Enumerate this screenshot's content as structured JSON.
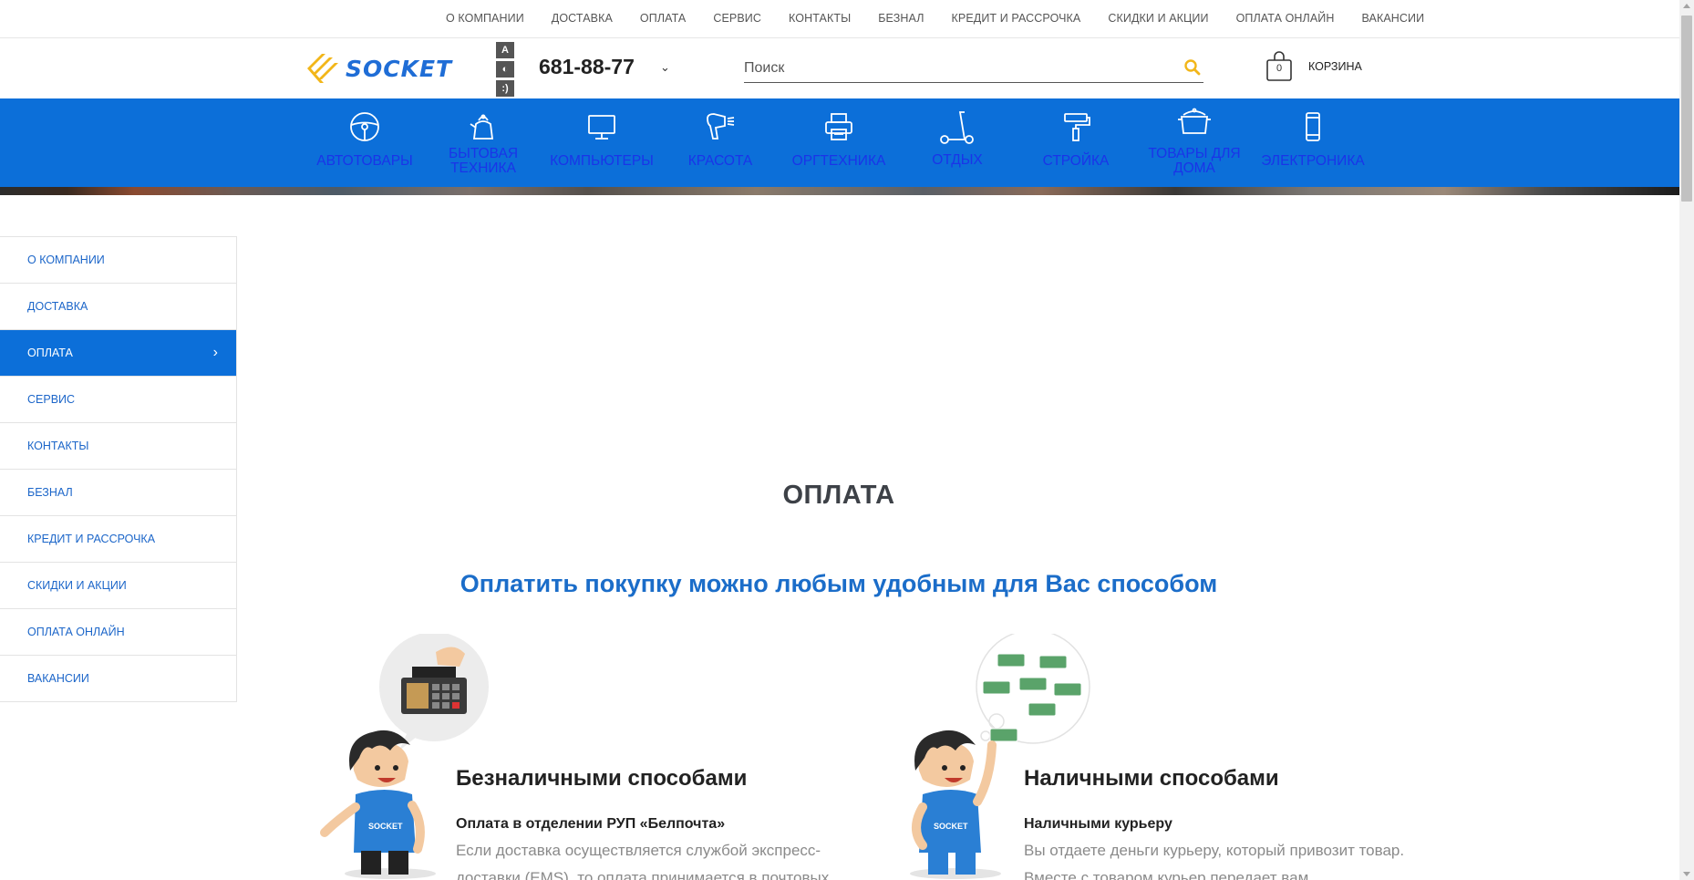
{
  "topnav": [
    "О КОМПАНИИ",
    "ДОСТАВКА",
    "ОПЛАТА",
    "СЕРВИС",
    "КОНТАКТЫ",
    "БЕЗНАЛ",
    "КРЕДИТ И РАССРОЧКА",
    "СКИДКИ И АКЦИИ",
    "ОПЛАТА ОНЛАЙН",
    "ВАКАНСИИ"
  ],
  "header": {
    "logo_text": "SOCKET",
    "access_buttons": [
      "A",
      "◐",
      ":)"
    ],
    "phone": "681-88-77",
    "search_placeholder": "Поиск",
    "cart_count": "0",
    "cart_label": "КОРЗИНА"
  },
  "categories": [
    {
      "label": "АВТОТОВАРЫ",
      "icon": "steering-wheel-icon"
    },
    {
      "label": "БЫТОВАЯ ТЕХНИКА",
      "icon": "kettle-icon"
    },
    {
      "label": "КОМПЬЮТЕРЫ",
      "icon": "monitor-icon"
    },
    {
      "label": "КРАСОТА",
      "icon": "hair-dryer-icon"
    },
    {
      "label": "ОРГТЕХНИКА",
      "icon": "printer-icon"
    },
    {
      "label": "ОТДЫХ",
      "icon": "scooter-icon"
    },
    {
      "label": "СТРОЙКА",
      "icon": "paint-roller-icon"
    },
    {
      "label": "ТОВАРЫ ДЛЯ ДОМА",
      "icon": "pot-icon"
    },
    {
      "label": "ЭЛЕКТРОНИКА",
      "icon": "smartphone-icon"
    }
  ],
  "sidebar": {
    "items": [
      "О КОМПАНИИ",
      "ДОСТАВКА",
      "ОПЛАТА",
      "СЕРВИС",
      "КОНТАКТЫ",
      "БЕЗНАЛ",
      "КРЕДИТ И РАССРОЧКА",
      "СКИДКИ И АКЦИИ",
      "ОПЛАТА ОНЛАЙН",
      "ВАКАНСИИ"
    ],
    "active": "ОПЛАТА"
  },
  "content": {
    "title": "ОПЛАТА",
    "subtitle": "Оплатить покупку можно любым удобным для Вас способом",
    "cashless": {
      "heading": "Безналичными способами",
      "sub": "Оплата в отделении РУП «Белпочта»",
      "text": "Если доставка осуществляется службой экспресс-доставки (EMS), то оплата принимается в почтовых отделениях"
    },
    "cash": {
      "heading": "Наличными способами",
      "sub": "Наличными курьеру",
      "text": "Вы отдаете деньги курьеру, который привозит товар. Вместе с товаром курьер передает вам"
    }
  },
  "colors": {
    "brand_blue": "#0c6fd9",
    "nav_label": "#1a34e8",
    "accent_yellow": "#f2b619"
  }
}
